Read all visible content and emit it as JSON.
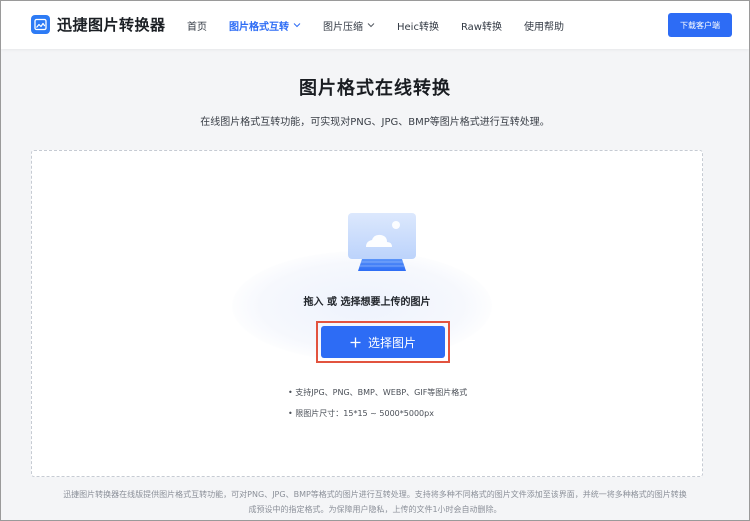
{
  "header": {
    "logo_text": "迅捷图片转换器",
    "nav": [
      {
        "label": "首页"
      },
      {
        "label": "图片格式互转"
      },
      {
        "label": "图片压缩"
      },
      {
        "label": "Heic转换"
      },
      {
        "label": "Raw转换"
      },
      {
        "label": "使用帮助"
      }
    ],
    "download_label": "下载客户端"
  },
  "main": {
    "title": "图片格式在线转换",
    "subtitle": "在线图片格式互转功能，可实现对PNG、JPG、BMP等图片格式进行互转处理。"
  },
  "upload": {
    "hint": "拖入 或 选择想要上传的图片",
    "button_label": "选择图片",
    "spec_formats": "• 支持JPG、PNG、BMP、WEBP、GIF等图片格式",
    "spec_size": "• 限图片尺寸：15*15 ~ 5000*5000px"
  },
  "footer": {
    "note": "迅捷图片转换器在线版提供图片格式互转功能，可对PNG、JPG、BMP等格式的图片进行互转处理。支持将多种不同格式的图片文件添加至该界面，并统一将多种格式的图片转换成预设中的指定格式。为保障用户隐私，上传的文件1小时会自动删除。"
  },
  "colors": {
    "accent": "#2d6cf5",
    "highlight_border": "#e2533f",
    "page_bg": "#f4f5f7"
  }
}
